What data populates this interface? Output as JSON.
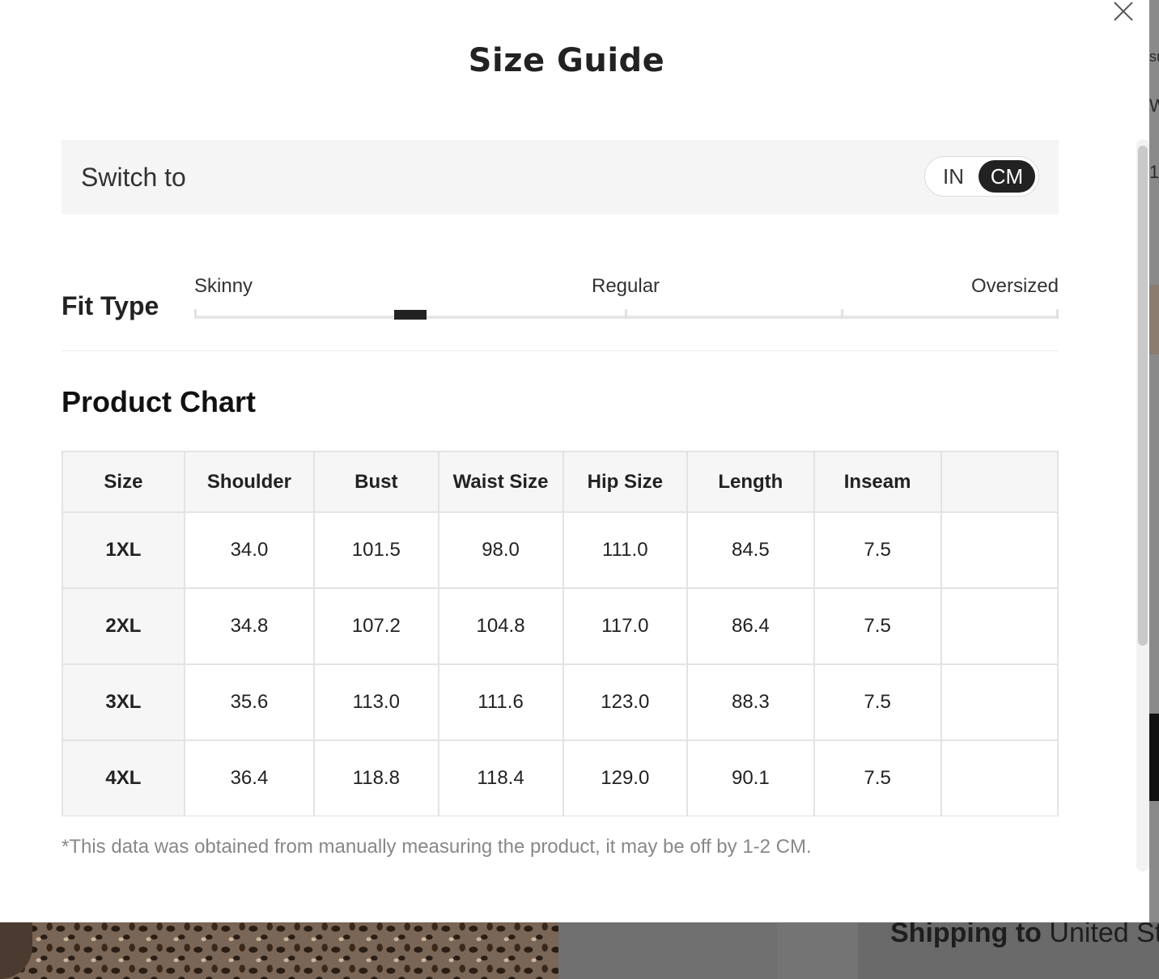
{
  "modal": {
    "title": "Size Guide",
    "close_icon": "close-icon"
  },
  "unit_switch": {
    "label": "Switch to",
    "options": [
      "IN",
      "CM"
    ],
    "selected": "CM"
  },
  "fit_type": {
    "label": "Fit Type",
    "ticks": [
      "Skinny",
      "Regular",
      "Oversized"
    ]
  },
  "product_chart": {
    "title": "Product Chart",
    "columns": [
      "Size",
      "Shoulder",
      "Bust",
      "Waist Size",
      "Hip Size",
      "Length",
      "Inseam"
    ],
    "rows": [
      [
        "1XL",
        "34.0",
        "101.5",
        "98.0",
        "111.0",
        "84.5",
        "7.5"
      ],
      [
        "2XL",
        "34.8",
        "107.2",
        "104.8",
        "117.0",
        "86.4",
        "7.5"
      ],
      [
        "3XL",
        "35.6",
        "113.0",
        "111.6",
        "123.0",
        "88.3",
        "7.5"
      ],
      [
        "4XL",
        "36.4",
        "118.8",
        "118.4",
        "129.0",
        "90.1",
        "7.5"
      ]
    ],
    "note": "*This data was obtained from manually measuring the product, it may be off by 1-2 CM."
  },
  "background": {
    "shipping_label": "Shipping to",
    "shipping_value": "United Sta"
  },
  "colors": {
    "accent": "#222222",
    "header_bg": "#f6f6f6",
    "note_text": "#888888"
  }
}
